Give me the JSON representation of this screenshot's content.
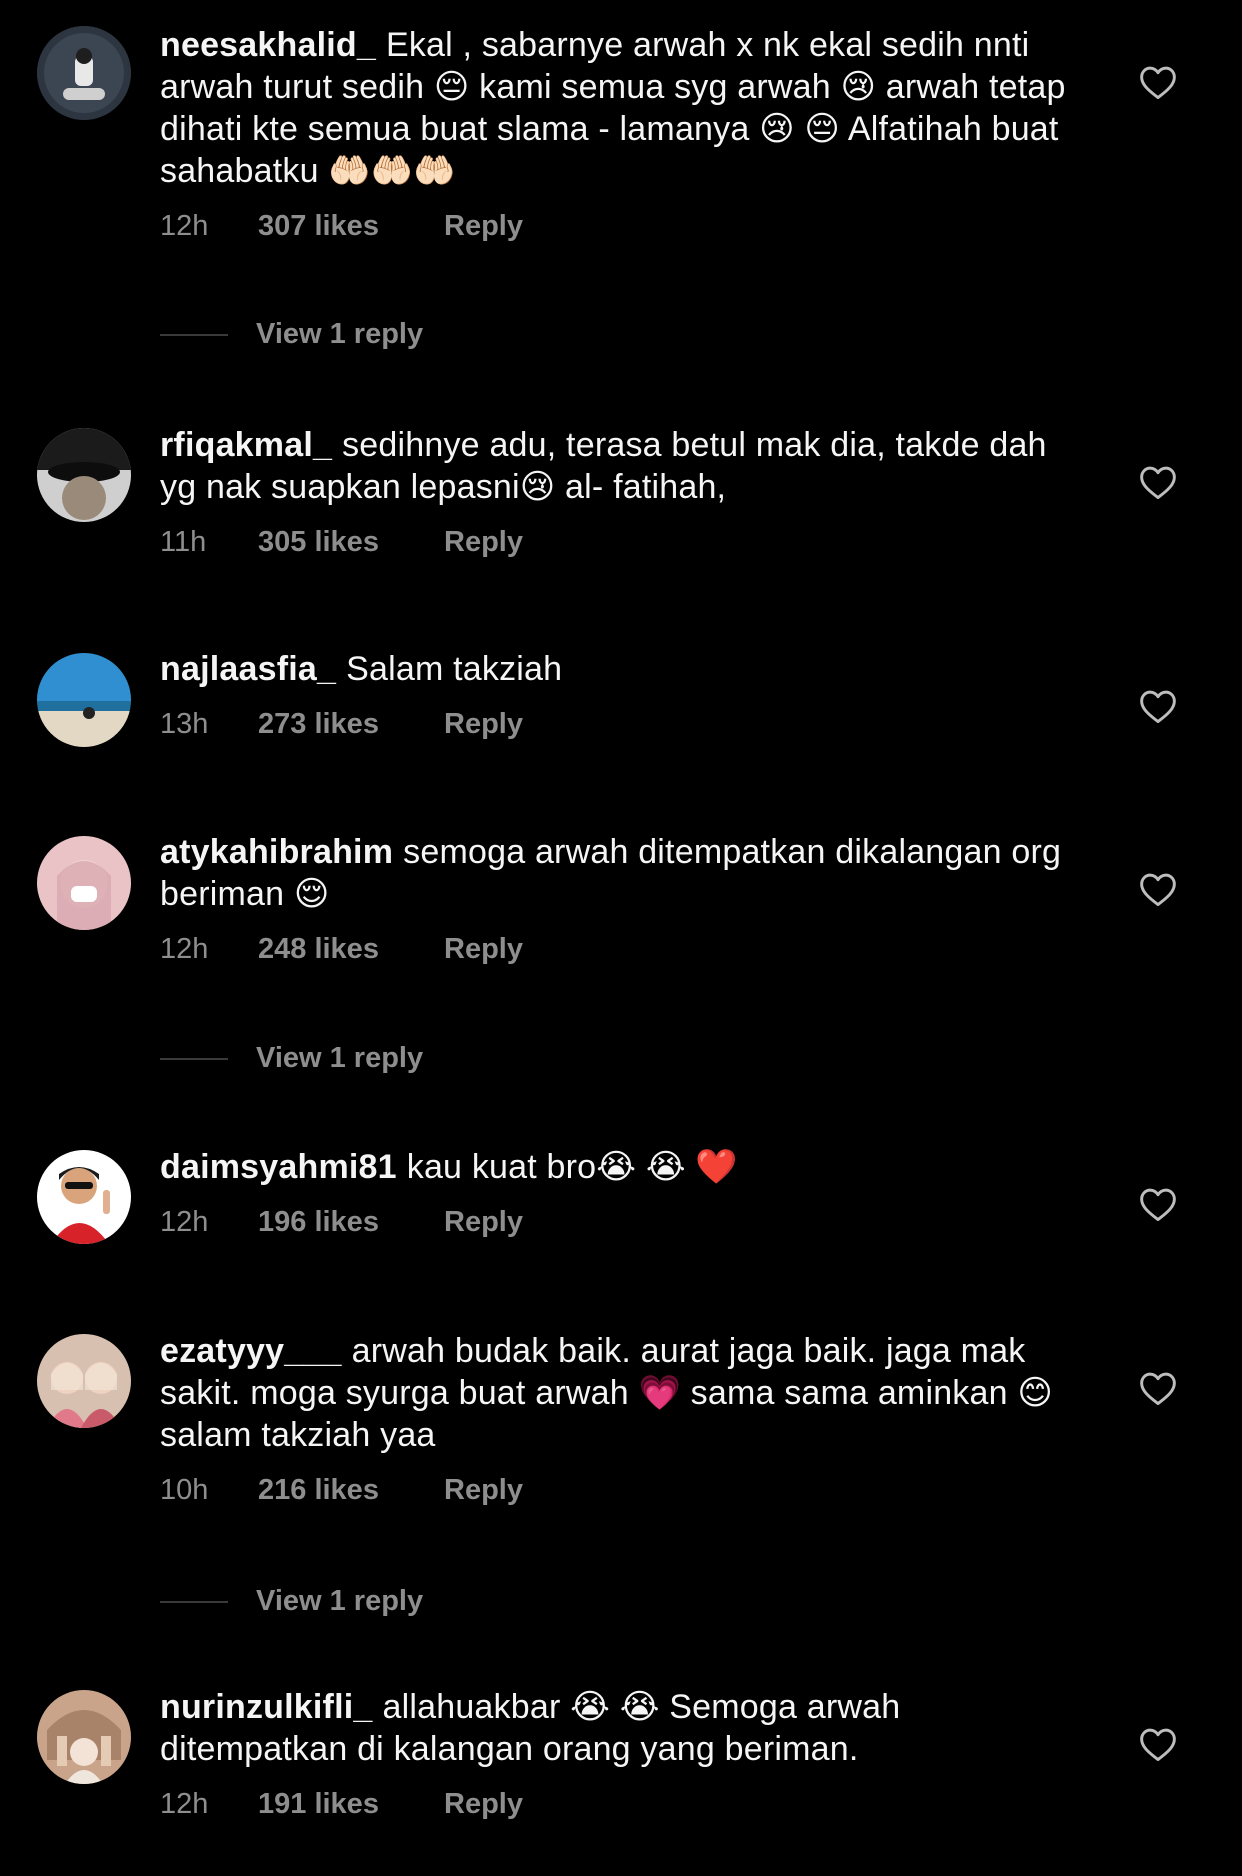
{
  "colors": {
    "background": "#000000",
    "text": "#f5f5f5",
    "secondary": "#8e8e8e",
    "divider": "#3a3a3a"
  },
  "comments": [
    {
      "username": "neesakhalid_",
      "text": "Ekal , sabarnye arwah x nk ekal sedih nnti arwah turut sedih 😔 kami semua syg arwah 😢 arwah tetap dihati kte semua buat slama - lamanya 😢 😔 Alfatihah buat sahabatku 🤲🏻🤲🏻🤲🏻",
      "time": "12h",
      "likes": "307 likes",
      "reply": "Reply",
      "view_replies": "View 1 reply"
    },
    {
      "username": "rfiqakmal_",
      "text": "sedihnye adu, terasa betul mak dia, takde dah yg nak suapkan lepasni😢 al- fatihah,",
      "time": "11h",
      "likes": "305 likes",
      "reply": "Reply"
    },
    {
      "username": "najlaasfia_",
      "text": "Salam takziah",
      "time": "13h",
      "likes": "273 likes",
      "reply": "Reply"
    },
    {
      "username": "atykahibrahim",
      "text": "semoga arwah ditempatkan dikalangan org beriman 😌",
      "time": "12h",
      "likes": "248 likes",
      "reply": "Reply",
      "view_replies": "View 1 reply"
    },
    {
      "username": "daimsyahmi81",
      "text": "kau kuat bro😭 😭 ❤️",
      "time": "12h",
      "likes": "196 likes",
      "reply": "Reply"
    },
    {
      "username": "ezatyyy___",
      "text": "arwah budak baik. aurat jaga baik. jaga mak sakit. moga syurga buat arwah 💗 sama sama aminkan 😊 salam takziah yaa",
      "time": "10h",
      "likes": "216 likes",
      "reply": "Reply",
      "view_replies": "View 1 reply"
    },
    {
      "username": "nurinzulkifli_",
      "text": "allahuakbar 😭 😭 Semoga arwah ditempatkan di kalangan orang yang beriman.",
      "time": "12h",
      "likes": "191 likes",
      "reply": "Reply"
    }
  ]
}
